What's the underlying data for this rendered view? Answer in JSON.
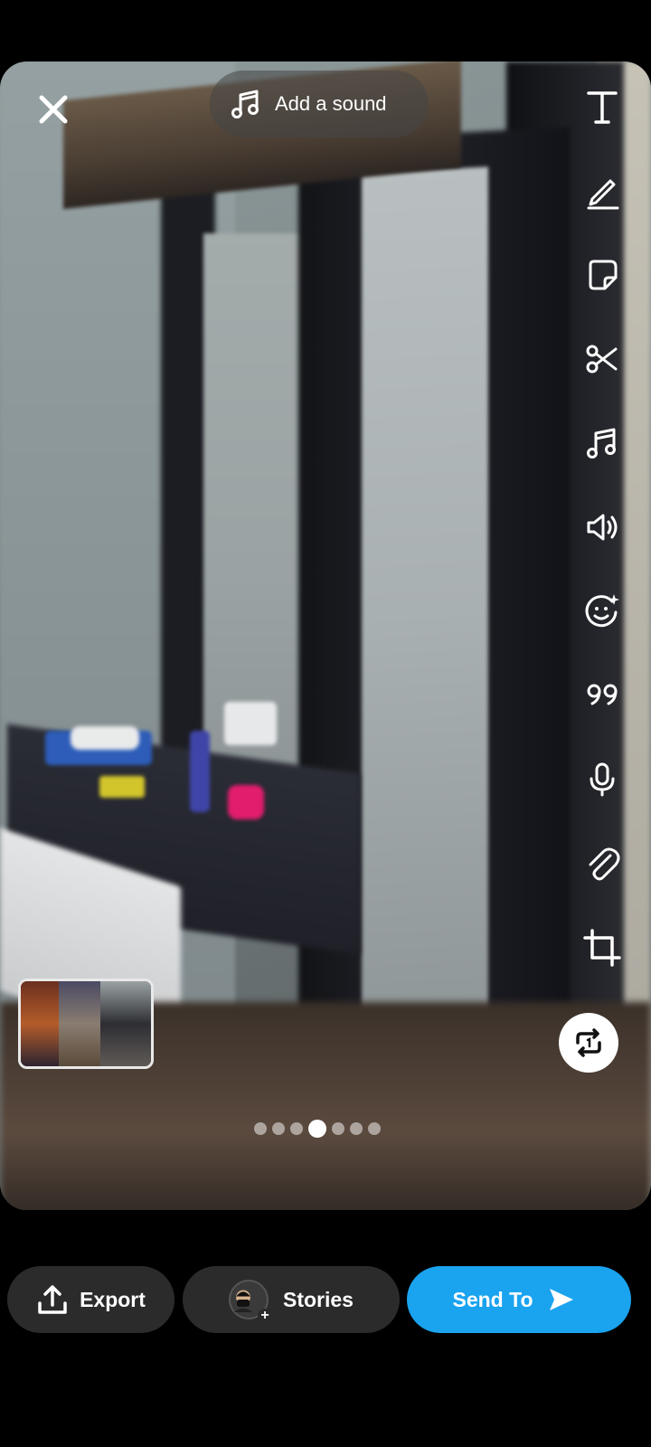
{
  "sound": {
    "label": "Add a sound"
  },
  "toolbar": {
    "tools": [
      "text-icon",
      "pen-icon",
      "sticker-icon",
      "scissors-icon",
      "music-icon",
      "volume-icon",
      "smile-sparkle-icon",
      "quote-icon",
      "mic-icon",
      "paperclip-icon",
      "crop-icon",
      "loop-icon"
    ]
  },
  "pager": {
    "count": 7,
    "active_index": 3
  },
  "bottom": {
    "export_label": "Export",
    "stories_label": "Stories",
    "send_label": "Send To"
  },
  "colors": {
    "send_button": "#1aa3ef",
    "pill_background": "#2b2b2b"
  }
}
